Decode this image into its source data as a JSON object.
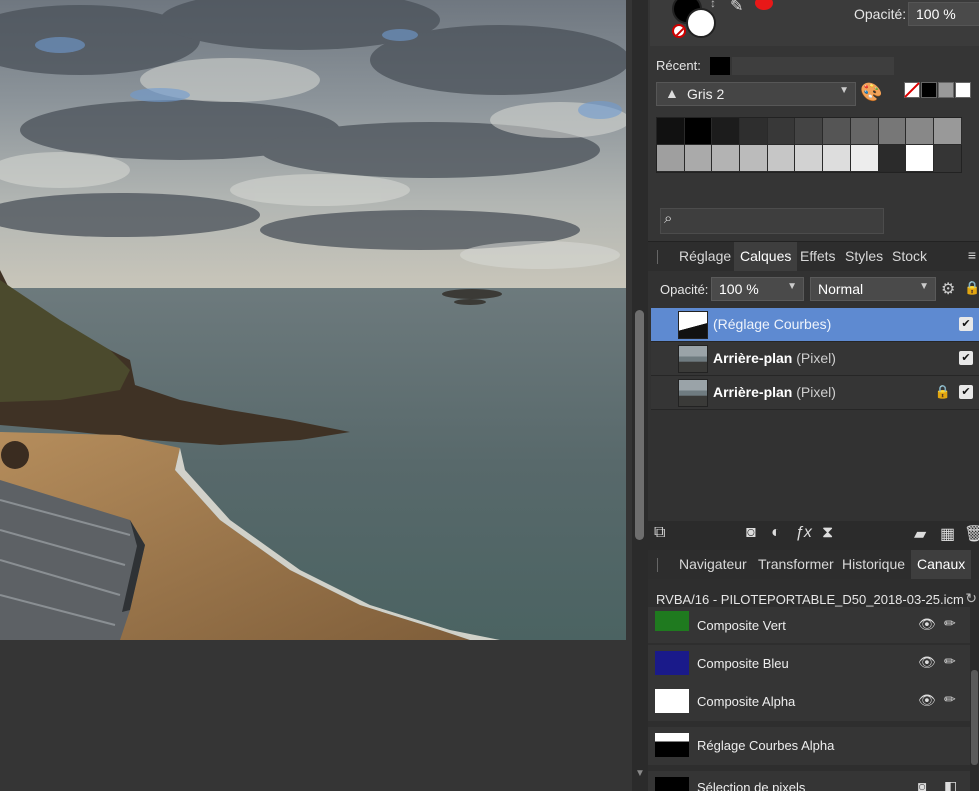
{
  "color_panel": {
    "opacity_label": "Opacité:",
    "opacity_value": "100 %",
    "recent_label": "Récent:",
    "palette_name": "Gris 2",
    "foreground_color": "#000000",
    "background_color": "#ffffff",
    "accent_red": "#e81818",
    "palette_swatches": [
      "#111111",
      "#000000",
      "#1c1c1c",
      "#2e2e2e",
      "#383838",
      "#444444",
      "#555555",
      "#666666",
      "#777777",
      "#888888",
      "#999999",
      "#9f9f9f",
      "#aaaaaa",
      "#b3b3b3",
      "#bbbbbb",
      "#c6c6c6",
      "#d2d2d2",
      "#dddddd",
      "#ededed",
      "#2b2b2b",
      "#ffffff"
    ]
  },
  "layers_panel": {
    "tabs": [
      {
        "label": "Réglage"
      },
      {
        "label": "Calques"
      },
      {
        "label": "Effets"
      },
      {
        "label": "Styles"
      },
      {
        "label": "Stock"
      }
    ],
    "active_tab": "Calques",
    "opacity_label": "Opacité:",
    "opacity_value": "100 %",
    "blend_mode": "Normal",
    "layers": [
      {
        "name": "(Réglage Courbes)",
        "type": "",
        "selected": true,
        "locked": false,
        "visible": true
      },
      {
        "name": "Arrière-plan",
        "type": "(Pixel)",
        "selected": false,
        "locked": false,
        "visible": true
      },
      {
        "name": "Arrière-plan",
        "type": "(Pixel)",
        "selected": false,
        "locked": true,
        "visible": true
      }
    ],
    "selection_color": "#5e8ad1"
  },
  "channels_panel": {
    "tabs": [
      {
        "label": "Navigateur"
      },
      {
        "label": "Transformer"
      },
      {
        "label": "Historique"
      },
      {
        "label": "Canaux"
      }
    ],
    "active_tab": "Canaux",
    "icc_profile": "RVBA/16 - PILOTEPORTABLE_D50_2018-03-25.icm",
    "channels": [
      {
        "name": "Composite Vert",
        "thumb_color": "#1f7a1f"
      },
      {
        "name": "Composite Bleu",
        "thumb_color": "#1a1a8a"
      },
      {
        "name": "Composite Alpha",
        "thumb_color": "#ffffff"
      },
      {
        "name": "Réglage Courbes Alpha",
        "thumb_color": "#000000"
      },
      {
        "name": "Sélection de pixels",
        "thumb_color": "#000000"
      }
    ]
  }
}
